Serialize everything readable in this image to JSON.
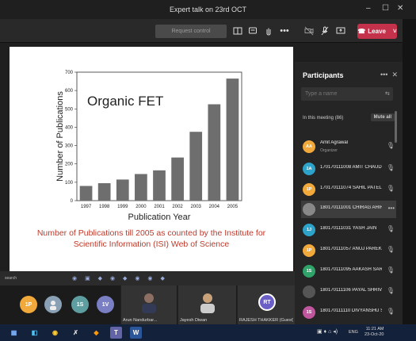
{
  "window": {
    "title": "Expert talk on 23rd OCT",
    "minimize": "–",
    "maximize": "☐",
    "close": "✕"
  },
  "toolbar": {
    "present_control": "Request control",
    "more": "•••",
    "leave_label": "Leave"
  },
  "slide": {
    "chart_data": {
      "type": "bar",
      "title": "Organic FET",
      "xlabel": "Publication Year",
      "ylabel": "Number of Publications",
      "categories": [
        "1997",
        "1998",
        "1999",
        "2000",
        "2001",
        "2002",
        "2003",
        "2004",
        "2005"
      ],
      "values": [
        80,
        95,
        115,
        145,
        165,
        235,
        375,
        525,
        665
      ],
      "ylim": [
        0,
        700
      ],
      "yticks": [
        0,
        100,
        200,
        300,
        400,
        500,
        600,
        700
      ],
      "bar_color": "#6e6e6e",
      "grid": false
    },
    "caption": "Number of Publications till 2005 as counted by the Institute for Scientific Information (ISI) Web of Science"
  },
  "meeting_bar": {
    "search": "search"
  },
  "video_tiles": [
    {
      "initials": "1P",
      "color": "#f2a93b"
    },
    {
      "initials": "",
      "color": "#8aa0b4"
    },
    {
      "initials": "1S",
      "color": "#5f9ea0"
    },
    {
      "initials": "1V",
      "color": "#7a7fc4"
    },
    {
      "name": "Arun Nandurbar...",
      "mic": "🎙"
    },
    {
      "name": "Jayesh Diwan",
      "mic": "🎙"
    },
    {
      "name": "RAJESH THAKKER (Guest)",
      "initials": "RT",
      "color": "#6b5fc7"
    }
  ],
  "participants": {
    "title": "Participants",
    "search_placeholder": "Type a name",
    "in_meeting": "In this meeting (86)",
    "mute_all": "Mute all",
    "list": [
      {
        "name": "Amit Agrawal",
        "role": "Organizer",
        "initials": "AA",
        "color": "#f2a93b"
      },
      {
        "name": "170170111008 AMIT CHAUD...",
        "initials": "1A",
        "color": "#2ea3c9"
      },
      {
        "name": "170170111074 SAHIL PATEL",
        "initials": "1P",
        "color": "#f2a93b"
      },
      {
        "name": "180170111001 CHIRAG AHIR",
        "initials": "",
        "color": "#888888"
      },
      {
        "name": "180170111031 YASH JAIN",
        "initials": "1J",
        "color": "#2ea3c9"
      },
      {
        "name": "180170111057 ANUJ PAREKH",
        "initials": "1P",
        "color": "#f2a93b"
      },
      {
        "name": "180170111095 AAKASH SARCH",
        "initials": "1S",
        "color": "#2fa36a"
      },
      {
        "name": "180170111106 PAYAL SHRIVAS",
        "initials": "",
        "color": "#555555"
      },
      {
        "name": "180170111110 DIVYANSHU S...",
        "initials": "1S",
        "color": "#c0569e"
      }
    ]
  },
  "taskbar": {
    "time": "11:21 AM",
    "date": "23-Oct-20",
    "lang": "ENG"
  }
}
